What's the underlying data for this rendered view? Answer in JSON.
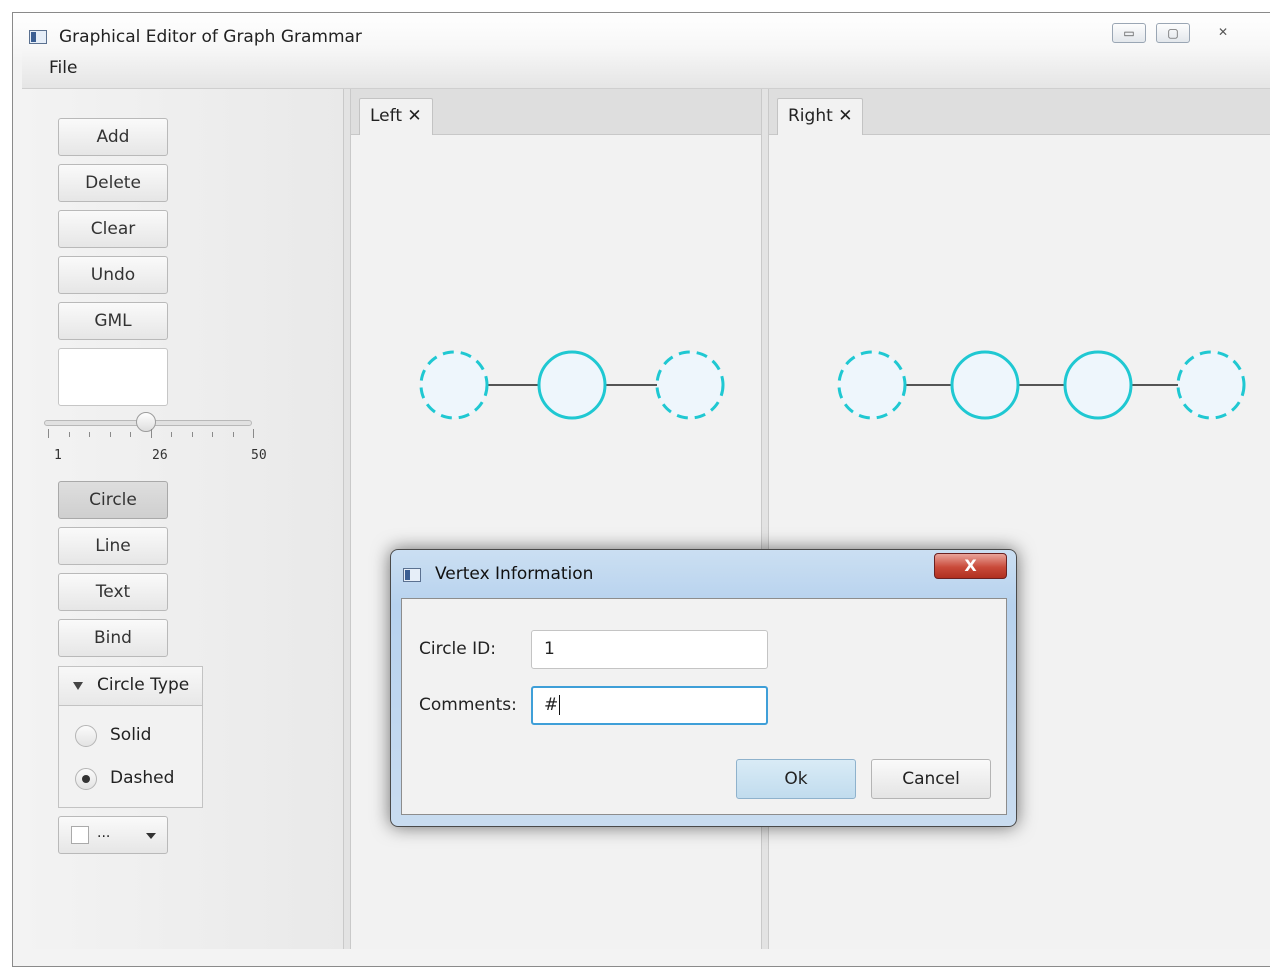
{
  "window": {
    "title": "Graphical Editor of Graph Grammar",
    "minimize": "▭",
    "restore": "▢",
    "close": "✕"
  },
  "menu": {
    "file": "File"
  },
  "toolbar": {
    "add": "Add",
    "delete": "Delete",
    "clear": "Clear",
    "undo": "Undo",
    "gml": "GML",
    "circle": "Circle",
    "line": "Line",
    "text": "Text",
    "bind": "Bind"
  },
  "slider": {
    "min": "1",
    "value": "26",
    "max": "50"
  },
  "circle_type": {
    "title": "Circle Type",
    "solid": "Solid",
    "dashed": "Dashed",
    "selected": "Dashed"
  },
  "color_picker": {
    "label": "...",
    "color": "#ffffff"
  },
  "tabs": {
    "left": "Left",
    "right": "Right",
    "close_glyph": "✕"
  },
  "graph_style": {
    "stroke": "#1fc8d2",
    "fill": "#eef6fc",
    "edge": "#555555"
  },
  "left_graph": {
    "vertices": [
      "dashed",
      "solid",
      "dashed"
    ]
  },
  "right_graph": {
    "vertices": [
      "dashed",
      "solid",
      "solid",
      "dashed"
    ]
  },
  "dialog": {
    "title": "Vertex Information",
    "close": "X",
    "circle_id_label": "Circle ID:",
    "circle_id_value": "1",
    "comments_label": "Comments:",
    "comments_value": "#",
    "ok": "Ok",
    "cancel": "Cancel"
  }
}
